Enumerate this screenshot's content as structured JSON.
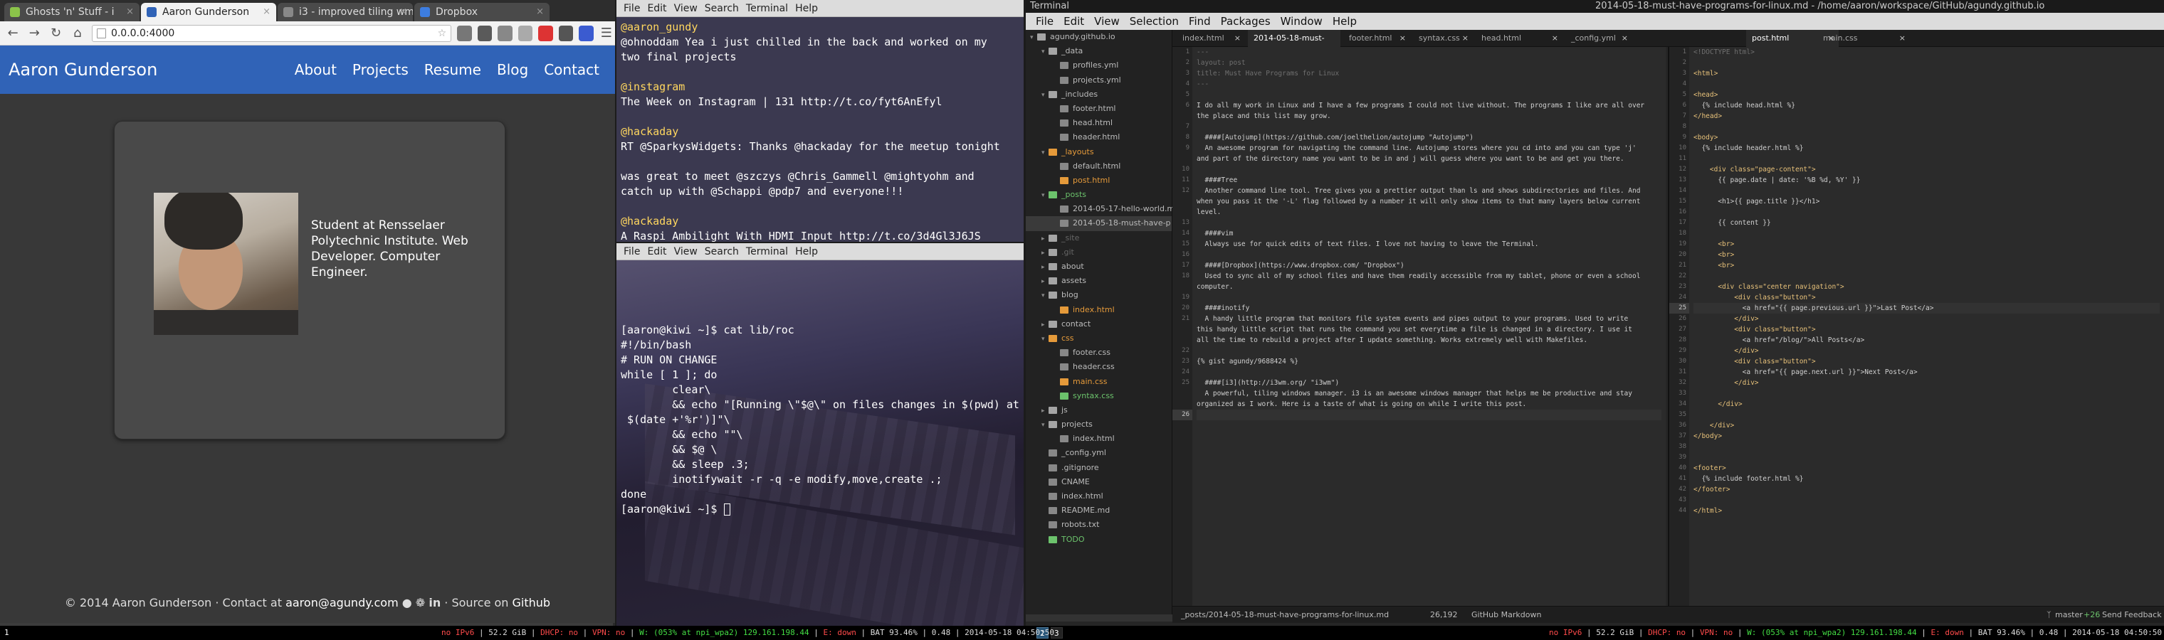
{
  "browser": {
    "tabs": [
      {
        "label": "Ghosts 'n' Stuff - i",
        "active": false
      },
      {
        "label": "Aaron Gunderson",
        "active": true
      },
      {
        "label": "i3 - improved tiling wm",
        "active": false
      },
      {
        "label": "Dropbox",
        "active": false
      }
    ],
    "url": "0.0.0.0:4000",
    "site": {
      "brand": "Aaron Gunderson",
      "nav": [
        "About",
        "Projects",
        "Resume",
        "Blog",
        "Contact"
      ],
      "bio": "Student at Rensselaer Polytechnic Institute. Web Developer. Computer Engineer.",
      "footer_prefix": "© 2014 Aaron Gunderson · Contact at",
      "footer_email": "aaron@agundy.com",
      "footer_mid": "· Source on",
      "footer_source": "Github",
      "footer_icons": [
        "github-icon",
        "twitter-icon",
        "linkedin-icon"
      ]
    },
    "accent": "#3063b7"
  },
  "terminal1": {
    "menu": [
      "File",
      "Edit",
      "View",
      "Search",
      "Terminal",
      "Help"
    ],
    "tweets": [
      {
        "user": "@aaron_gundy",
        "text": "@ohnoddam Yea i just chilled in the back and worked on my\ntwo final projects"
      },
      {
        "user": "@instagram",
        "text": "The Week on Instagram | 131 http://t.co/fyt6AnEfyl"
      },
      {
        "user": "@hackaday",
        "text": "RT @SparkysWidgets: Thanks @hackaday for the meetup tonight\n\nwas great to meet @szczys @Chris_Gammell @mightyohm and\ncatch up with @Schappi @pdp7 and everyone!!!"
      },
      {
        "user": "@hackaday",
        "text": "A Raspi Ambilight With HDMI Input http://t.co/3d4Gl3J6JS"
      }
    ]
  },
  "terminal2": {
    "menu": [
      "File",
      "Edit",
      "View",
      "Search",
      "Terminal",
      "Help"
    ],
    "lines": [
      "[aaron@kiwi ~]$ cat lib/roc",
      "#!/bin/bash",
      "",
      "# RUN ON CHANGE",
      "",
      "while [ 1 ]; do",
      "        clear\\",
      "        && echo \"[Running \\\"$@\\\" on files changes in $(pwd) at",
      " $(date +'%r')]\"\\",
      "        && echo \"\"\\",
      "        && $@ \\",
      "        && sleep .3;",
      "        inotifywait -r -q -e modify,move,create .;",
      "done",
      "[aaron@kiwi ~]$ "
    ]
  },
  "editor": {
    "title_app": "Terminal",
    "title_path": "2014-05-18-must-have-programs-for-linux.md - /home/aaron/workspace/GitHub/agundy.github.io",
    "menu": [
      "File",
      "Edit",
      "View",
      "Selection",
      "Find",
      "Packages",
      "Window",
      "Help"
    ],
    "tree": [
      {
        "label": "agundy.github.io",
        "depth": 0,
        "kind": "dir",
        "open": true
      },
      {
        "label": "_data",
        "depth": 1,
        "kind": "dir",
        "open": true
      },
      {
        "label": "profiles.yml",
        "depth": 2,
        "kind": "file"
      },
      {
        "label": "projects.yml",
        "depth": 2,
        "kind": "file"
      },
      {
        "label": "_includes",
        "depth": 1,
        "kind": "dir",
        "open": true
      },
      {
        "label": "footer.html",
        "depth": 2,
        "kind": "file"
      },
      {
        "label": "head.html",
        "depth": 2,
        "kind": "file"
      },
      {
        "label": "header.html",
        "depth": 2,
        "kind": "file"
      },
      {
        "label": "_layouts",
        "depth": 1,
        "kind": "dir",
        "open": true,
        "color": "orange"
      },
      {
        "label": "default.html",
        "depth": 2,
        "kind": "file"
      },
      {
        "label": "post.html",
        "depth": 2,
        "kind": "file",
        "color": "orange"
      },
      {
        "label": "_posts",
        "depth": 1,
        "kind": "dir",
        "open": true,
        "color": "green"
      },
      {
        "label": "2014-05-17-hello-world.md",
        "depth": 2,
        "kind": "file"
      },
      {
        "label": "2014-05-18-must-have-p",
        "depth": 2,
        "kind": "file",
        "selected": true
      },
      {
        "label": "_site",
        "depth": 1,
        "kind": "dir",
        "color": "dim"
      },
      {
        "label": ".git",
        "depth": 1,
        "kind": "dir",
        "color": "dim"
      },
      {
        "label": "about",
        "depth": 1,
        "kind": "dir"
      },
      {
        "label": "assets",
        "depth": 1,
        "kind": "dir"
      },
      {
        "label": "blog",
        "depth": 1,
        "kind": "dir",
        "open": true
      },
      {
        "label": "index.html",
        "depth": 2,
        "kind": "file",
        "color": "orange"
      },
      {
        "label": "contact",
        "depth": 1,
        "kind": "dir"
      },
      {
        "label": "css",
        "depth": 1,
        "kind": "dir",
        "open": true,
        "color": "orange"
      },
      {
        "label": "footer.css",
        "depth": 2,
        "kind": "file"
      },
      {
        "label": "header.css",
        "depth": 2,
        "kind": "file"
      },
      {
        "label": "main.css",
        "depth": 2,
        "kind": "file",
        "color": "orange"
      },
      {
        "label": "syntax.css",
        "depth": 2,
        "kind": "file",
        "color": "green"
      },
      {
        "label": "js",
        "depth": 1,
        "kind": "dir"
      },
      {
        "label": "projects",
        "depth": 1,
        "kind": "dir",
        "open": true
      },
      {
        "label": "index.html",
        "depth": 2,
        "kind": "file"
      },
      {
        "label": "_config.yml",
        "depth": 1,
        "kind": "file"
      },
      {
        "label": ".gitignore",
        "depth": 1,
        "kind": "file"
      },
      {
        "label": "CNAME",
        "depth": 1,
        "kind": "file"
      },
      {
        "label": "index.html",
        "depth": 1,
        "kind": "file"
      },
      {
        "label": "README.md",
        "depth": 1,
        "kind": "file"
      },
      {
        "label": "robots.txt",
        "depth": 1,
        "kind": "file"
      },
      {
        "label": "TODO",
        "depth": 1,
        "kind": "file",
        "color": "green"
      }
    ],
    "tabs": [
      {
        "label": "index.html",
        "active": false
      },
      {
        "label": "2014-05-18-must-have...",
        "active": true
      },
      {
        "label": "footer.html",
        "active": false
      },
      {
        "label": "syntax.css",
        "active": false
      },
      {
        "label": "head.html",
        "active": false
      },
      {
        "label": "_config.yml",
        "active": false
      },
      {
        "label": "post.html",
        "active": true
      },
      {
        "label": "main.css",
        "active": false
      }
    ],
    "left_code": [
      {
        "n": "1",
        "t": "---",
        "c": "gray"
      },
      {
        "n": "2",
        "t": "layout: post",
        "c": "gray"
      },
      {
        "n": "3",
        "t": "title: Must Have Programs for Linux",
        "c": "gray"
      },
      {
        "n": "4",
        "t": "---",
        "c": "gray"
      },
      {
        "n": "5",
        "t": ""
      },
      {
        "n": "6",
        "t": "I do all my work in Linux and I have a few programs I could not live without. The programs I like are all over"
      },
      {
        "n": "",
        "t": "the place and this list may grow."
      },
      {
        "n": "7",
        "t": ""
      },
      {
        "n": "8",
        "t": "  ####[Autojump](https://github.com/joelthelion/autojump \"Autojump\")"
      },
      {
        "n": "9",
        "t": "  An awesome program for navigating the command line. Autojump stores where you cd into and you can type 'j'"
      },
      {
        "n": "",
        "t": "and part of the directory name you want to be in and j will guess where you want to be and get you there."
      },
      {
        "n": "10",
        "t": ""
      },
      {
        "n": "11",
        "t": "  ####Tree"
      },
      {
        "n": "12",
        "t": "  Another command line tool. Tree gives you a prettier output than ls and shows subdirectories and files. And"
      },
      {
        "n": "",
        "t": "when you pass it the '-L' flag followed by a number it will only show items to that many layers below current"
      },
      {
        "n": "",
        "t": "level."
      },
      {
        "n": "13",
        "t": ""
      },
      {
        "n": "14",
        "t": "  ####vim"
      },
      {
        "n": "15",
        "t": "  Always use for quick edits of text files. I love not having to leave the Terminal."
      },
      {
        "n": "16",
        "t": ""
      },
      {
        "n": "17",
        "t": "  ####[Dropbox](https://www.dropbox.com/ \"Dropbox\")"
      },
      {
        "n": "18",
        "t": "  Used to sync all of my school files and have them readily accessible from my tablet, phone or even a school"
      },
      {
        "n": "",
        "t": "computer."
      },
      {
        "n": "19",
        "t": ""
      },
      {
        "n": "20",
        "t": "  ####inotify"
      },
      {
        "n": "21",
        "t": "  A handy little program that monitors file system events and pipes output to your programs. Used to write"
      },
      {
        "n": "",
        "t": "this handy little script that runs the command you set everytime a file is changed in a directory. I use it"
      },
      {
        "n": "",
        "t": "all the time to rebuild a project after I update something. Works extremely well with Makefiles."
      },
      {
        "n": "22",
        "t": ""
      },
      {
        "n": "23",
        "t": "{% gist agundy/9688424 %}"
      },
      {
        "n": "24",
        "t": ""
      },
      {
        "n": "25",
        "t": "  ####[i3](http://i3wm.org/ \"i3wm\")"
      },
      {
        "n": "",
        "t": "  A powerful, tiling windows manager. i3 is an awesome windows manager that helps me be productive and stay"
      },
      {
        "n": "",
        "t": "organized as I work. Here is a taste of what is going on while I write this post."
      },
      {
        "n": "26",
        "t": "",
        "cur": true
      }
    ],
    "right_code": [
      {
        "n": "1",
        "t": "<!DOCTYPE html>",
        "c": "gray"
      },
      {
        "n": "2",
        "t": ""
      },
      {
        "n": "3",
        "t": "<html>",
        "c": "tag"
      },
      {
        "n": "4",
        "t": ""
      },
      {
        "n": "5",
        "t": "<head>",
        "c": "tag"
      },
      {
        "n": "6",
        "t": "  {% include head.html %}"
      },
      {
        "n": "7",
        "t": "</head>",
        "c": "tag"
      },
      {
        "n": "8",
        "t": ""
      },
      {
        "n": "9",
        "t": "<body>",
        "c": "tag"
      },
      {
        "n": "10",
        "t": "  {% include header.html %}"
      },
      {
        "n": "11",
        "t": ""
      },
      {
        "n": "12",
        "t": "    <div class=\"page-content\">",
        "c": "tag"
      },
      {
        "n": "13",
        "t": "      {{ page.date | date: '%B %d, %Y' }}"
      },
      {
        "n": "14",
        "t": ""
      },
      {
        "n": "15",
        "t": "      <h1>{{ page.title }}</h1>"
      },
      {
        "n": "16",
        "t": ""
      },
      {
        "n": "17",
        "t": "      {{ content }}"
      },
      {
        "n": "18",
        "t": ""
      },
      {
        "n": "19",
        "t": "      <br>",
        "c": "tag"
      },
      {
        "n": "20",
        "t": "      <br>",
        "c": "tag"
      },
      {
        "n": "21",
        "t": "      <br>",
        "c": "tag"
      },
      {
        "n": "22",
        "t": ""
      },
      {
        "n": "23",
        "t": "      <div class=\"center navigation\">",
        "c": "tag"
      },
      {
        "n": "24",
        "t": "          <div class=\"button\">",
        "c": "tag"
      },
      {
        "n": "25",
        "t": "            <a href=\"{{ page.previous.url }}\">Last Post</a>",
        "cur": true
      },
      {
        "n": "26",
        "t": "          </div>",
        "c": "tag"
      },
      {
        "n": "27",
        "t": "          <div class=\"button\">",
        "c": "tag"
      },
      {
        "n": "28",
        "t": "            <a href=\"/blog/\">All Posts</a>"
      },
      {
        "n": "29",
        "t": "          </div>",
        "c": "tag"
      },
      {
        "n": "30",
        "t": "          <div class=\"button\">",
        "c": "tag"
      },
      {
        "n": "31",
        "t": "            <a href=\"{{ page.next.url }}\">Next Post</a>"
      },
      {
        "n": "32",
        "t": "          </div>",
        "c": "tag"
      },
      {
        "n": "33",
        "t": ""
      },
      {
        "n": "34",
        "t": "      </div>",
        "c": "tag"
      },
      {
        "n": "35",
        "t": ""
      },
      {
        "n": "36",
        "t": "    </div>",
        "c": "tag"
      },
      {
        "n": "37",
        "t": "</body>",
        "c": "tag"
      },
      {
        "n": "38",
        "t": ""
      },
      {
        "n": "39",
        "t": ""
      },
      {
        "n": "40",
        "t": "<footer>",
        "c": "tag"
      },
      {
        "n": "41",
        "t": "  {% include footer.html %}"
      },
      {
        "n": "42",
        "t": "</footer>",
        "c": "tag"
      },
      {
        "n": "43",
        "t": ""
      },
      {
        "n": "44",
        "t": "</html>",
        "c": "tag"
      }
    ],
    "status": {
      "path": "_posts/2014-05-18-must-have-programs-for-linux.md",
      "pos": "26,192",
      "grammar": "GitHub Markdown",
      "branch": "master",
      "diff": "+26",
      "feedback": "Send Feedback"
    }
  },
  "i3bar": {
    "workspaces": [
      "1",
      "2",
      "3"
    ],
    "focused_workspace": "2",
    "status_left": [
      {
        "t": "no IPv6",
        "c": "red"
      },
      {
        "t": " | 52.2 GiB | ",
        "c": ""
      },
      {
        "t": "DHCP: no",
        "c": "red"
      },
      {
        "t": " | ",
        "c": ""
      },
      {
        "t": "VPN: no",
        "c": "red"
      },
      {
        "t": " | ",
        "c": ""
      },
      {
        "t": "W: (053% at npi_wpa2) 129.161.198.44",
        "c": "green"
      },
      {
        "t": " | ",
        "c": ""
      },
      {
        "t": "E: down",
        "c": "red"
      },
      {
        "t": " | BAT 93.46% | 0.48 | 2014-05-18 04:50:50",
        "c": ""
      }
    ]
  }
}
